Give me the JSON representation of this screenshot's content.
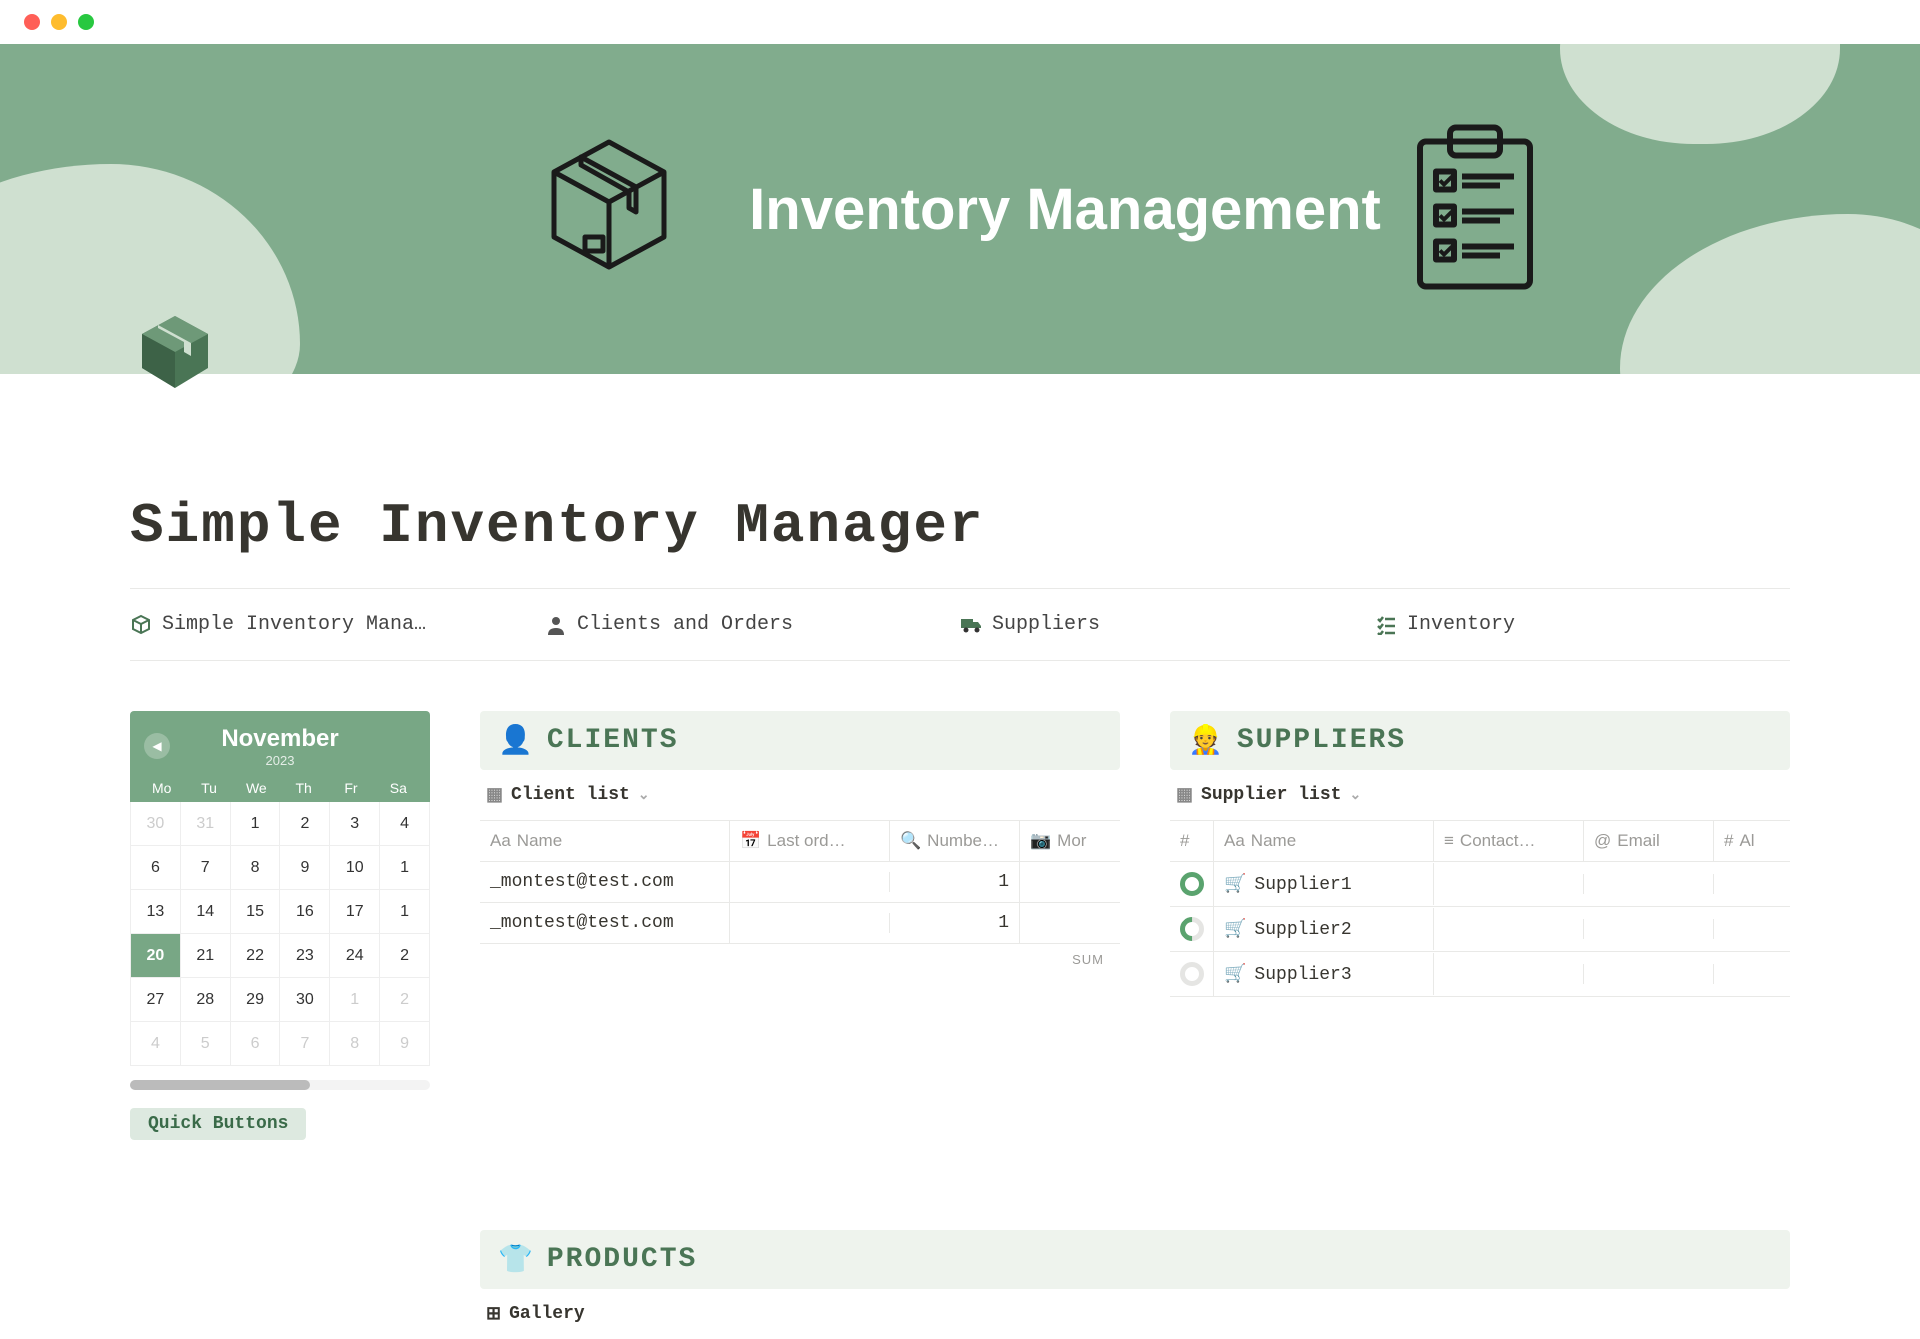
{
  "hero": {
    "title": "Inventory Management"
  },
  "page": {
    "title": "Simple Inventory Manager"
  },
  "tabs": [
    {
      "icon": "box",
      "label": "Simple Inventory Mana…"
    },
    {
      "icon": "user",
      "label": "Clients and Orders"
    },
    {
      "icon": "truck",
      "label": "Suppliers"
    },
    {
      "icon": "checklist",
      "label": "Inventory"
    }
  ],
  "calendar": {
    "month": "November",
    "year": "2023",
    "dow": [
      "Mo",
      "Tu",
      "We",
      "Th",
      "Fr",
      "Sa"
    ],
    "cells": [
      {
        "d": "30",
        "dim": true
      },
      {
        "d": "31",
        "dim": true
      },
      {
        "d": "1"
      },
      {
        "d": "2"
      },
      {
        "d": "3"
      },
      {
        "d": "4"
      },
      {
        "d": "6"
      },
      {
        "d": "7"
      },
      {
        "d": "8"
      },
      {
        "d": "9"
      },
      {
        "d": "10"
      },
      {
        "d": "1"
      },
      {
        "d": "13"
      },
      {
        "d": "14"
      },
      {
        "d": "15"
      },
      {
        "d": "16"
      },
      {
        "d": "17"
      },
      {
        "d": "1"
      },
      {
        "d": "20",
        "today": true
      },
      {
        "d": "21"
      },
      {
        "d": "22"
      },
      {
        "d": "23"
      },
      {
        "d": "24"
      },
      {
        "d": "2"
      },
      {
        "d": "27"
      },
      {
        "d": "28"
      },
      {
        "d": "29"
      },
      {
        "d": "30"
      },
      {
        "d": "1",
        "dim": true
      },
      {
        "d": "2",
        "dim": true
      },
      {
        "d": "4",
        "dim": true
      },
      {
        "d": "5",
        "dim": true
      },
      {
        "d": "6",
        "dim": true
      },
      {
        "d": "7",
        "dim": true
      },
      {
        "d": "8",
        "dim": true
      },
      {
        "d": "9",
        "dim": true
      }
    ],
    "quick_buttons": "Quick Buttons"
  },
  "clients": {
    "emoji": "👤",
    "title": "CLIENTS",
    "view_label": "Client list",
    "columns": [
      "Name",
      "Last ord…",
      "Numbe…",
      "Mor"
    ],
    "rows": [
      {
        "name": "_montest@test.com",
        "last_order": "",
        "number": "1",
        "more": ""
      },
      {
        "name": "_montest@test.com",
        "last_order": "",
        "number": "1",
        "more": ""
      }
    ],
    "sum_label": "SUM"
  },
  "suppliers": {
    "emoji": "👷",
    "title": "SUPPLIERS",
    "view_label": "Supplier list",
    "columns": [
      "#",
      "Name",
      "Contact…",
      "Email",
      "Al"
    ],
    "rows": [
      {
        "status": "green",
        "name": "Supplier1"
      },
      {
        "status": "partial",
        "name": "Supplier2"
      },
      {
        "status": "empty",
        "name": "Supplier3"
      }
    ]
  },
  "products": {
    "emoji": "👕",
    "title": "PRODUCTS",
    "view_label": "Gallery"
  }
}
